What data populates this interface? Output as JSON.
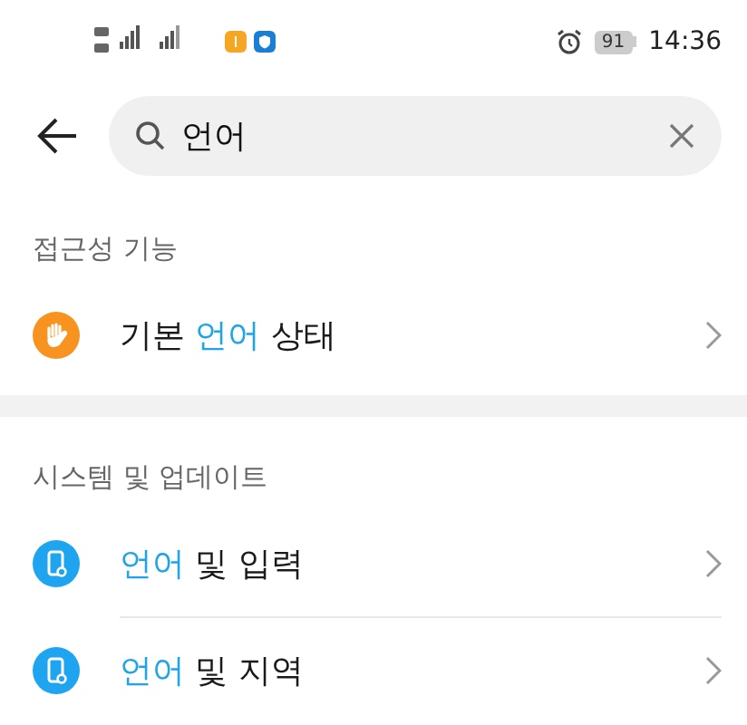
{
  "status_bar": {
    "battery": "91",
    "time": "14:36"
  },
  "search": {
    "value": "언어"
  },
  "sections": [
    {
      "title": "접근성 기능",
      "items": [
        {
          "kind": "accessibility",
          "parts": [
            {
              "text": "기본 ",
              "highlight": false
            },
            {
              "text": "언어",
              "highlight": true
            },
            {
              "text": " 상태",
              "highlight": false
            }
          ]
        }
      ]
    },
    {
      "title": "시스템 및 업데이트",
      "items": [
        {
          "kind": "system",
          "parts": [
            {
              "text": "언어",
              "highlight": true
            },
            {
              "text": " 및 입력",
              "highlight": false
            }
          ]
        },
        {
          "kind": "system",
          "parts": [
            {
              "text": "언어",
              "highlight": true
            },
            {
              "text": " 및 지역",
              "highlight": false
            }
          ]
        }
      ]
    }
  ]
}
